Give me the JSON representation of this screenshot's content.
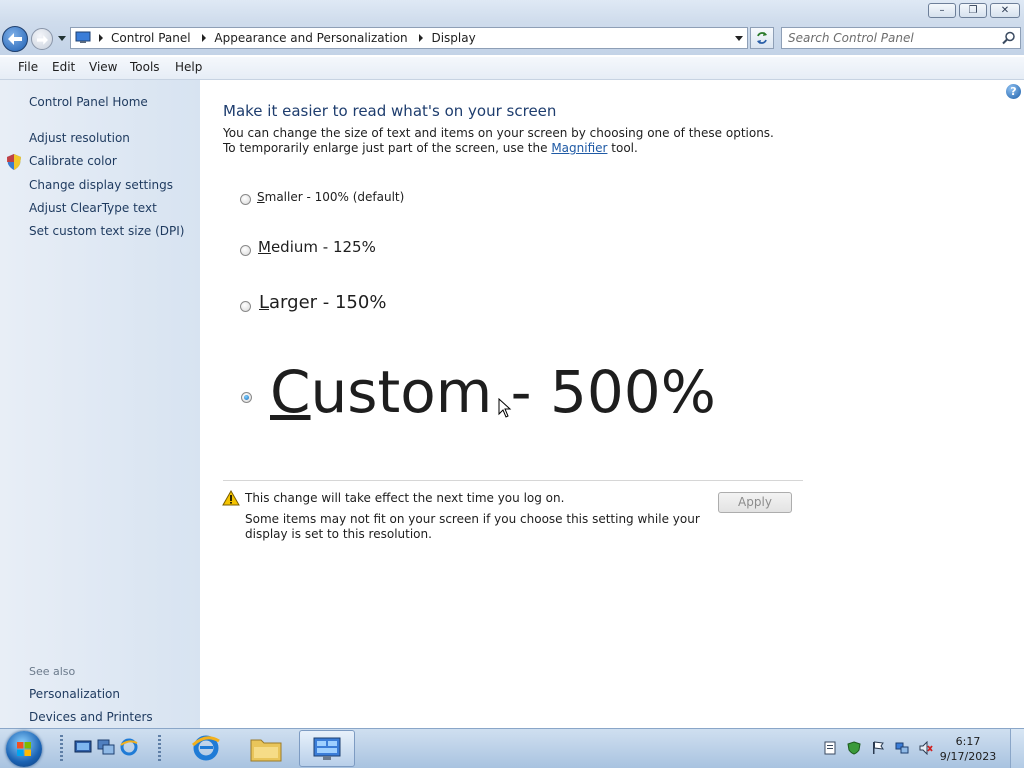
{
  "window": {
    "controls": {
      "minimize": "–",
      "restore": "❐",
      "close": "✕"
    }
  },
  "address": {
    "crumbs": [
      "Control Panel",
      "Appearance and Personalization",
      "Display"
    ],
    "search_placeholder": "Search Control Panel"
  },
  "menu": [
    "File",
    "Edit",
    "View",
    "Tools",
    "Help"
  ],
  "sidebar": {
    "home": "Control Panel Home",
    "links": [
      "Adjust resolution",
      "Calibrate color",
      "Change display settings",
      "Adjust ClearType text",
      "Set custom text size (DPI)"
    ],
    "see_also_title": "See also",
    "see_also": [
      "Personalization",
      "Devices and Printers"
    ]
  },
  "main": {
    "heading": "Make it easier to read what's on your screen",
    "desc_part1": "You can change the size of text and items on your screen by choosing one of these options. To temporarily enlarge just part of the screen, use the ",
    "desc_link": "Magnifier",
    "desc_part2": " tool.",
    "options": [
      {
        "accel": "S",
        "rest": "maller - 100% (default)",
        "checked": false
      },
      {
        "accel": "M",
        "rest": "edium - 125%",
        "checked": false
      },
      {
        "accel": "L",
        "rest": "arger - 150%",
        "checked": false
      },
      {
        "accel": "C",
        "rest": "ustom - 500%",
        "checked": true
      }
    ],
    "warning_title": "This change will take effect the next time you log on.",
    "warning_detail": "Some items may not fit on your screen if you choose this setting while your display is set to this resolution.",
    "apply_label": "Apply"
  },
  "taskbar": {
    "clock_time": "6:17",
    "clock_date": "9/17/2023"
  }
}
